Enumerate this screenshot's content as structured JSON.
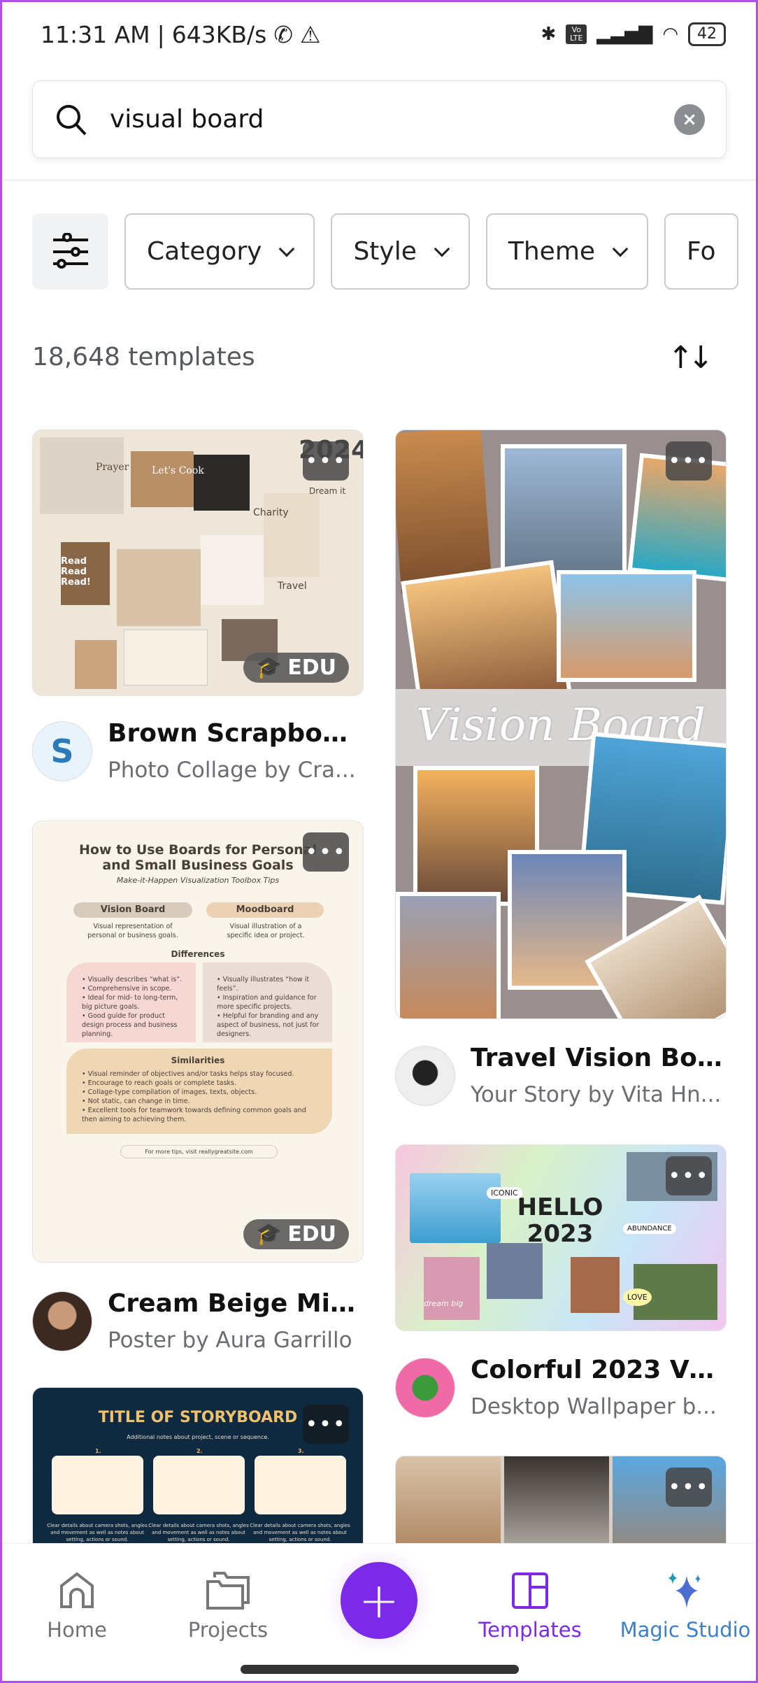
{
  "status_bar": {
    "time": "11:31 AM",
    "speed": "643KB/s",
    "battery": "42",
    "volte": "Vo LTE"
  },
  "search": {
    "query": "visual board",
    "icon": "search-icon"
  },
  "filters": {
    "chips": [
      "Category",
      "Style",
      "Theme",
      "Fo"
    ]
  },
  "results": {
    "count": "18,648 templates"
  },
  "badges": {
    "edu": "EDU",
    "more": "•••"
  },
  "colors": {
    "accent": "#7d2ae8",
    "magic": "#2f8fb8",
    "border": "#b04ef0"
  },
  "templates": [
    {
      "title": "Brown Scrapbook...",
      "subtitle": "Photo Collage by Cra...",
      "thumb": {
        "year": "2024",
        "labels": [
          "Prayer",
          "Let's Cook",
          "Charity",
          "Read Read Read!",
          "Travel",
          "Dream it"
        ]
      }
    },
    {
      "title": "Cream Beige Mini...",
      "subtitle": "Poster by Aura Garrillo",
      "thumb": {
        "heading": "How to Use Boards for Personal and Small Business Goals",
        "tagline": "Make-it-Happen Visualization Toolbox Tips",
        "left_pill": "Vision Board",
        "left_desc": "Visual representation of personal or business goals.",
        "right_pill": "Moodboard",
        "right_desc": "Visual illustration of a specific idea or project.",
        "diff_title": "Differences",
        "left_points": "• Visually describes “what is”.\n• Comprehensive in scope.\n• Ideal for mid- to long-term, big picture goals.\n• Good guide for product design process and business planning.",
        "right_points": "• Visually illustrates “how it feels”.\n• Inspiration and guidance for more specific projects.\n• Helpful for branding and any aspect of business, not just for designers.",
        "sim_title": "Similarities",
        "sim_points": "• Visual reminder of objectives and/or tasks helps stay focused.\n• Encourage to reach goals or complete tasks.\n• Collage-type compilation of images, texts, objects.\n• Not static, can change in time.\n• Excellent tools for teamwork towards defining common goals and then aiming to achieving them.",
        "footer": "For more tips, visit reallygreatsite.com"
      }
    },
    {
      "title": "",
      "subtitle": "",
      "thumb": {
        "heading": "TITLE OF STORYBOARD",
        "tagline": "Additional notes about project, scene or sequence.",
        "numbers": [
          "1.",
          "2.",
          "3."
        ],
        "caption": "Clear details about camera shots, angles and movement as well as notes about setting, actions or sound."
      }
    },
    {
      "title": "Travel Vision Boar...",
      "subtitle": "Your Story by Vita Hn...",
      "thumb": {
        "heading": "Vision Board"
      }
    },
    {
      "title": "Colorful 2023 Visi...",
      "subtitle": "Desktop Wallpaper b...",
      "thumb": {
        "heading": "HELLO 2023",
        "labels": [
          "ICONIC",
          "ABUNDANCE",
          "LOVE",
          "dream big"
        ]
      }
    }
  ],
  "nav": {
    "items": [
      {
        "label": "Home",
        "icon": "home-icon"
      },
      {
        "label": "Projects",
        "icon": "folder-icon"
      },
      {
        "label": "Templates",
        "icon": "templates-icon",
        "active": true
      },
      {
        "label": "Magic Studio",
        "icon": "sparkle-icon"
      }
    ],
    "create": "+"
  }
}
